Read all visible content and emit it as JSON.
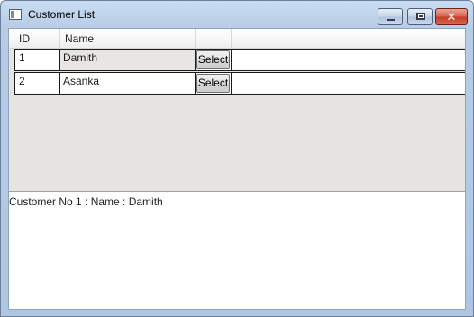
{
  "window": {
    "title": "Customer List",
    "controls": {
      "minimize": "minimize-icon",
      "maximize": "maximize-icon",
      "close": "close-icon"
    }
  },
  "grid": {
    "columns": [
      "ID",
      "Name",
      ""
    ],
    "rows": [
      {
        "id": "1",
        "name": "Damith",
        "action": "Select"
      },
      {
        "id": "2",
        "name": "Asanka",
        "action": "Select"
      }
    ]
  },
  "status": {
    "text": "Customer No 1 : Name : Damith"
  },
  "colors": {
    "title_bar": "#b7cde6",
    "grid_background": "#e7e5e1",
    "close_button": "#c23b25"
  }
}
